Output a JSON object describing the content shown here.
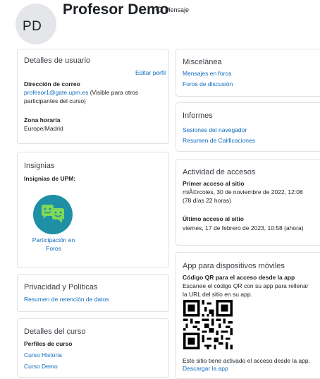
{
  "header": {
    "avatar_initials": "PD",
    "name": "Profesor Demo",
    "message_label": "Mensaje"
  },
  "user_details": {
    "title": "Detalles de usuario",
    "edit_link": "Editar perfil",
    "email_label": "Dirección de correo",
    "email_value": "profesor1@gate.upm.es",
    "email_note_1": " (Visible para otros",
    "email_note_2": "participantes del curso)",
    "timezone_label": "Zona horaria",
    "timezone_value": "Europe/Madrid"
  },
  "badges": {
    "title": "Insignias",
    "subtitle": "Insignias de UPM:",
    "badge_label_1": "Participación en",
    "badge_label_2": "Foros"
  },
  "privacy": {
    "title": "Privacidad y Políticas",
    "link": "Resumen de retención de datos"
  },
  "course_details": {
    "title": "Detalles del curso",
    "label": "Perfiles de curso",
    "course_1": "Curso Historia",
    "course_2": "Curso Demo"
  },
  "misc": {
    "title": "Miscelánea",
    "link_1": "Mensajes en foros",
    "link_2": "Foros de discusión"
  },
  "reports": {
    "title": "Informes",
    "link_1": "Sesiones del navegador",
    "link_2": "Resumen de Calificaciones"
  },
  "access": {
    "title": "Actividad de accesos",
    "first_label": "Primer acceso al sitio",
    "first_value_1": "miÃ©rcoles, 30 de noviembre de 2022, 12:08",
    "first_value_2": "(78 días 22 horas)",
    "last_label": "Último acceso al sitio",
    "last_value": "viernes, 17 de febrero de 2023, 10:58  (ahora)"
  },
  "mobile": {
    "title": "App para dispositivos móviles",
    "qr_label": "Código QR para el acceso desde la app",
    "qr_text_1": "Escanee el código QR con su app para rellenar",
    "qr_text_2": "la URL del sitio en su app.",
    "enabled_text": "Este sitio tiene activado el acceso desde la app.",
    "download_link": "Descargar la app"
  },
  "colors": {
    "link": "#0f6cbf",
    "badge_bg": "#1f8fa6",
    "badge_fg": "#7ed957"
  }
}
